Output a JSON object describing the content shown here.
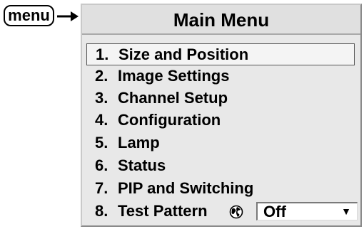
{
  "menu_key": {
    "label": "menu"
  },
  "arrow_icon": "right-arrow-icon",
  "main_menu": {
    "title": "Main Menu",
    "items": [
      {
        "number": "1.",
        "label": "Size and Position",
        "selected": true
      },
      {
        "number": "2.",
        "label": "Image Settings"
      },
      {
        "number": "3.",
        "label": "Channel Setup"
      },
      {
        "number": "4.",
        "label": "Configuration"
      },
      {
        "number": "5.",
        "label": "Lamp"
      },
      {
        "number": "6.",
        "label": "Status"
      },
      {
        "number": "7.",
        "label": "PIP and Switching"
      },
      {
        "number": "8.",
        "label": "Test Pattern",
        "icon": "globe-icon",
        "value": "Off",
        "dropdown_icon": "triangle-down-icon"
      }
    ]
  }
}
